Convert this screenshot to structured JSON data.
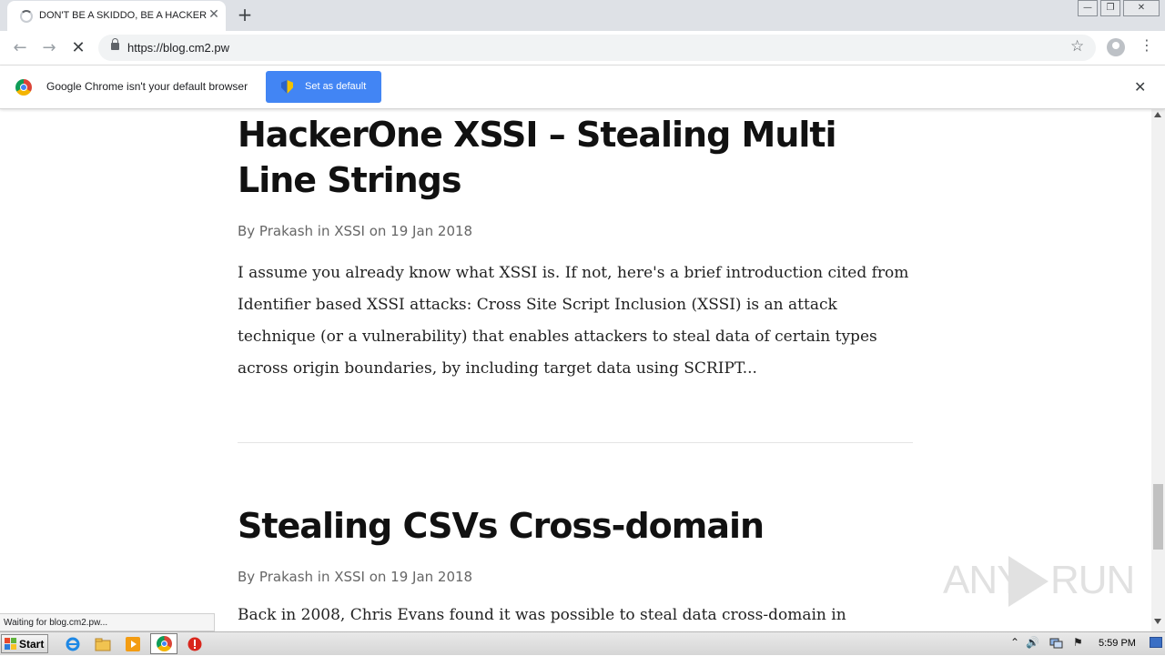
{
  "browser": {
    "tab_title": "DON'T BE A SKIDDO, BE A HACKER",
    "tab_close": "✕",
    "new_tab": "+",
    "url": "https://blog.cm2.pw",
    "win_minimize": "—",
    "win_restore": "❐",
    "win_close": "✕",
    "back": "←",
    "forward": "→",
    "stop": "✕",
    "star": "☆",
    "menu": "⋮"
  },
  "infobar": {
    "message": "Google Chrome isn't your default browser",
    "button_label": "Set as default",
    "close": "✕"
  },
  "posts": [
    {
      "title": "HackerOne XSSI – Stealing Multi Line Strings",
      "meta": "By Prakash in XSSI on 19 Jan 2018",
      "excerpt": "I assume you already know what XSSI is. If not, here's a brief introduction cited from Identifier based XSSI attacks: Cross Site Script Inclusion (XSSI) is an attack technique (or a vulnerability) that enables attackers to steal data of certain types across origin boundaries, by including target data using SCRIPT..."
    },
    {
      "title": "Stealing CSVs Cross-domain",
      "meta": "By Prakash in XSSI on 19 Jan 2018",
      "excerpt": "Back in 2008, Chris Evans found it was possible to steal data cross-domain in"
    }
  ],
  "status_bar": "Waiting for blog.cm2.pw...",
  "watermark": {
    "left": "ANY",
    "right": "RUN"
  },
  "taskbar": {
    "start_label": "Start",
    "clock": "5:59 PM",
    "tray_up": "⌃",
    "tray_speaker": "🔊",
    "tray_flag": "⚑"
  },
  "colors": {
    "accent": "#4285f4",
    "tabstrip": "#dee1e6",
    "title_text": "#111111",
    "meta_text": "#666666"
  }
}
